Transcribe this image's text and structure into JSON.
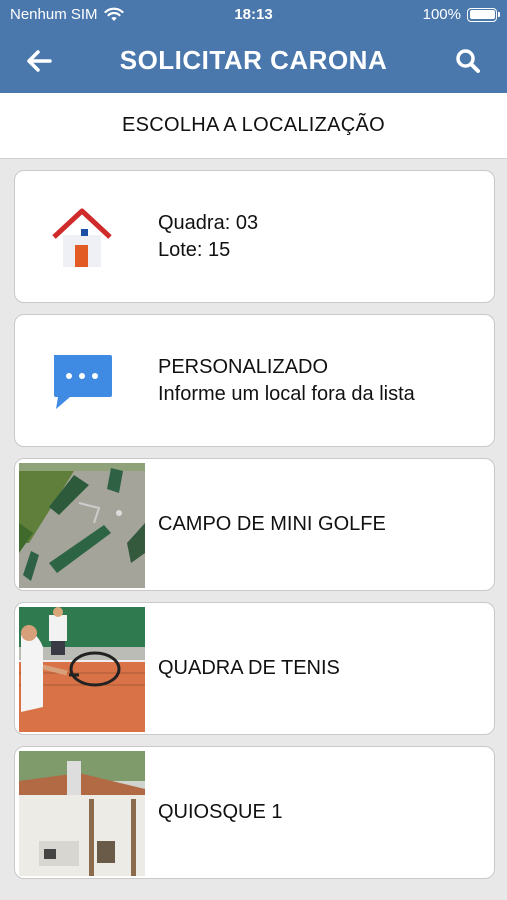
{
  "status_bar": {
    "carrier": "Nenhum SIM",
    "time": "18:13",
    "battery": "100%"
  },
  "nav": {
    "title": "SOLICITAR CARONA",
    "back_icon": "arrow-left-icon",
    "search_icon": "search-icon"
  },
  "subheader": {
    "title": "ESCOLHA A LOCALIZAÇÃO"
  },
  "locations": [
    {
      "icon": "house-icon",
      "line1": "Quadra: 03",
      "line2": "Lote: 15"
    },
    {
      "icon": "chat-bubble-icon",
      "line1": "PERSONALIZADO",
      "line2": "Informe um local fora da lista"
    },
    {
      "icon": "mini-golf-photo",
      "line1": "CAMPO DE MINI GOLFE"
    },
    {
      "icon": "tennis-court-photo",
      "line1": "QUADRA DE TENIS"
    },
    {
      "icon": "kiosk-photo",
      "line1": "QUIOSQUE 1"
    }
  ],
  "colors": {
    "primary": "#4a78ad",
    "background": "#e8e8e8",
    "card": "#ffffff"
  }
}
